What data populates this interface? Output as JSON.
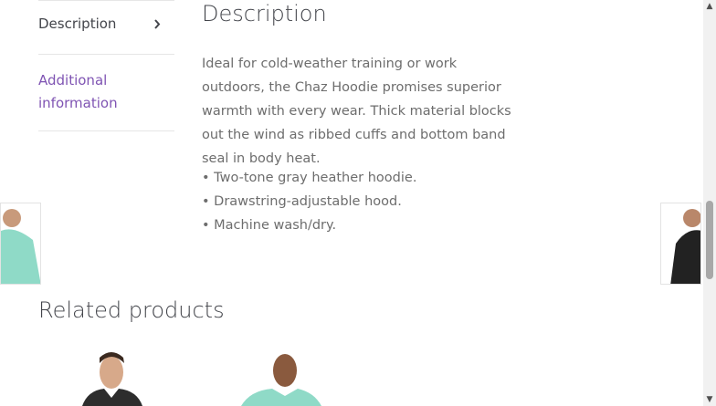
{
  "tabs": {
    "items": [
      {
        "label": "Description"
      },
      {
        "label": "Additional information"
      }
    ]
  },
  "panel": {
    "title": "Description",
    "body": "Ideal for cold-weather training or work outdoors, the Chaz Hoodie promises superior warmth with every wear. Thick material blocks out the wind as ribbed cuffs and bottom band seal in body heat.",
    "bullets": [
      "• Two-tone gray heather hoodie.",
      "• Drawstring-adjustable hood.",
      "• Machine wash/dry."
    ]
  },
  "related": {
    "title": "Related products"
  },
  "colors": {
    "accent": "#7f54b3",
    "text": "#43454b",
    "muted": "#6d6d6d"
  }
}
